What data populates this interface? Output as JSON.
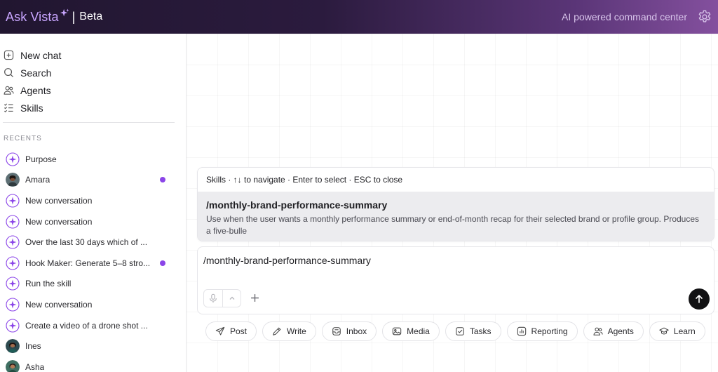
{
  "header": {
    "brand": "Ask Vista",
    "separator": "|",
    "beta": "Beta",
    "tagline": "AI powered command center",
    "colors": {
      "brand": "#c9a6ff",
      "gradient_start": "#211630",
      "gradient_end": "#84509e"
    }
  },
  "sidebar": {
    "nav": [
      {
        "label": "New chat",
        "icon": "new-chat-icon"
      },
      {
        "label": "Search",
        "icon": "search-icon"
      },
      {
        "label": "Agents",
        "icon": "agents-icon"
      },
      {
        "label": "Skills",
        "icon": "skills-icon"
      }
    ],
    "recents_label": "RECENTS",
    "recents": [
      {
        "label": "Purpose",
        "icon": "sparkle-icon"
      },
      {
        "label": "Amara",
        "icon": "avatar",
        "unread": true
      },
      {
        "label": "New conversation",
        "icon": "sparkle-icon"
      },
      {
        "label": "New conversation",
        "icon": "sparkle-icon"
      },
      {
        "label": "Over the last 30 days which of ...",
        "icon": "sparkle-icon"
      },
      {
        "label": "Hook Maker: Generate 5–8 stro...",
        "icon": "sparkle-icon",
        "unread": true
      },
      {
        "label": "Run the skill",
        "icon": "sparkle-icon"
      },
      {
        "label": "New conversation",
        "icon": "sparkle-icon"
      },
      {
        "label": "Create a video of a drone shot ...",
        "icon": "sparkle-icon"
      },
      {
        "label": "Ines",
        "icon": "avatar"
      },
      {
        "label": "Asha",
        "icon": "avatar"
      }
    ],
    "colors": {
      "unread": "#8b45e8",
      "sparkle": "#8b45e8"
    }
  },
  "skills_popup": {
    "hint": "Skills · ↑↓ to navigate · Enter to select · ESC to close",
    "item_title": "/monthly-brand-performance-summary",
    "item_desc": "Use when the user wants a monthly performance summary or end-of-month recap for their selected brand or profile group. Produces a five-bulle"
  },
  "composer": {
    "value": "/monthly-brand-performance-summary"
  },
  "chips": [
    {
      "label": "Post",
      "icon": "send-icon"
    },
    {
      "label": "Write",
      "icon": "pencil-icon"
    },
    {
      "label": "Inbox",
      "icon": "inbox-icon"
    },
    {
      "label": "Media",
      "icon": "image-icon"
    },
    {
      "label": "Tasks",
      "icon": "checkbox-icon"
    },
    {
      "label": "Reporting",
      "icon": "chart-icon"
    },
    {
      "label": "Agents",
      "icon": "agents-icon"
    },
    {
      "label": "Learn",
      "icon": "graduation-cap-icon"
    }
  ]
}
